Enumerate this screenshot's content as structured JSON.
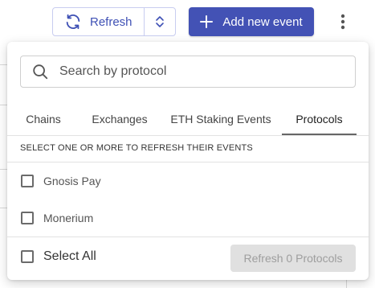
{
  "toolbar": {
    "refresh_label": "Refresh",
    "add_event_label": "Add new event"
  },
  "panel": {
    "search": {
      "placeholder": "Search by protocol",
      "value": ""
    },
    "tabs": [
      {
        "label": "Chains",
        "active": false
      },
      {
        "label": "Exchanges",
        "active": false
      },
      {
        "label": "ETH Staking Events",
        "active": false
      },
      {
        "label": "Protocols",
        "active": true
      }
    ],
    "section_heading": "SELECT ONE OR MORE TO REFRESH THEIR EVENTS",
    "items": [
      {
        "label": "Gnosis Pay",
        "checked": false
      },
      {
        "label": "Monerium",
        "checked": false
      }
    ],
    "select_all_label": "Select All",
    "refresh_button_label": "Refresh 0 Protocols"
  },
  "colors": {
    "primary": "#4352b5",
    "outline_text": "#3f51b5",
    "disabled_bg": "#e0e0e0",
    "disabled_text": "#9e9e9e"
  },
  "icons": [
    "refresh-icon",
    "unfold-icon",
    "plus-icon",
    "more-vert-icon",
    "search-icon"
  ]
}
